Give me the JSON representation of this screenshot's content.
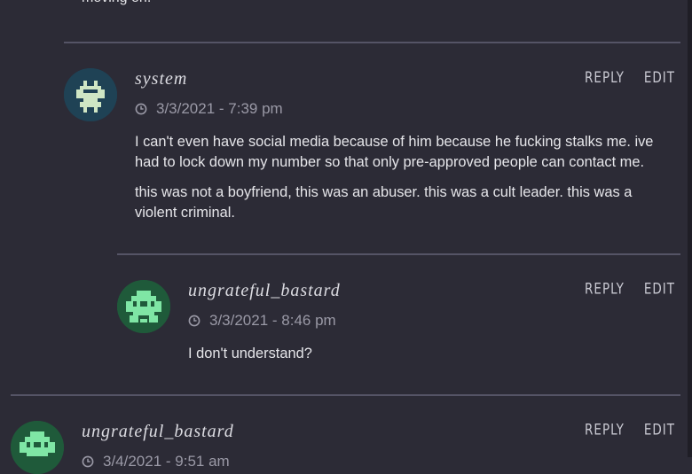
{
  "top_fragment": "moving on.",
  "comments": [
    {
      "author": "system",
      "timestamp": "3/3/2021 - 7:39 pm",
      "reply_label": "Reply",
      "edit_label": "Edit",
      "paragraphs": [
        "I can't even have social media because of him because he fucking stalks me. ive had to lock down my number so that only pre-approved people can contact me.",
        "this was not a boyfriend, this was an abuser. this was a cult leader. this was a violent criminal."
      ],
      "avatar_color": "#1f4255",
      "avatar_glyph_color": "#cfe6c4"
    },
    {
      "author": "ungrateful_bastard",
      "timestamp": "3/3/2021 - 8:46 pm",
      "reply_label": "Reply",
      "edit_label": "Edit",
      "paragraphs": [
        "I don't understand?"
      ],
      "avatar_color": "#1f5a3a",
      "avatar_glyph_color": "#7fe6a5"
    },
    {
      "author": "ungrateful_bastard",
      "timestamp": "3/4/2021 - 9:51 am",
      "reply_label": "Reply",
      "edit_label": "Edit",
      "avatar_color": "#1f5a3a",
      "avatar_glyph_color": "#7fe6a5"
    }
  ],
  "icons": {
    "clock": "clock-icon"
  },
  "colors": {
    "background": "#2c2b36",
    "divider": "#555466",
    "muted_text": "#9a99a6"
  }
}
